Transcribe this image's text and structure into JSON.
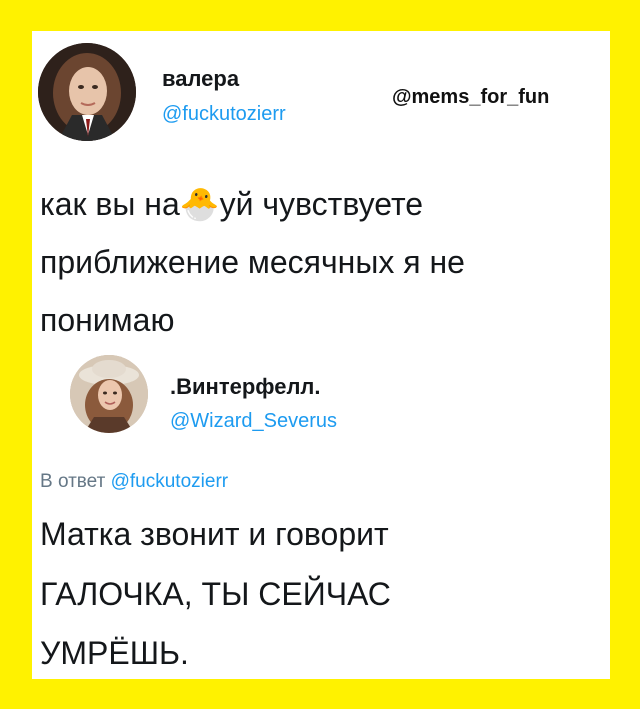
{
  "tweet1": {
    "name": "валера",
    "handle": "@fuckutozierr",
    "lines": [
      "как вы на🐣уй чувствуете",
      "приближение месячных я не",
      "понимаю"
    ]
  },
  "watermark": "@mems_for_fun",
  "tweet2": {
    "name": ".Винтерфелл.",
    "handle": "@Wizard_Severus",
    "reply_prefix": "В ответ",
    "reply_handle": "@fuckutozierr",
    "lines": [
      "Матка звонит и говорит",
      "ГАЛОЧКА, ТЫ СЕЙЧАС",
      "УМРЁШЬ."
    ]
  },
  "colors": {
    "frame": "#fff200",
    "link": "#1d9bf0",
    "text": "#14171a"
  }
}
